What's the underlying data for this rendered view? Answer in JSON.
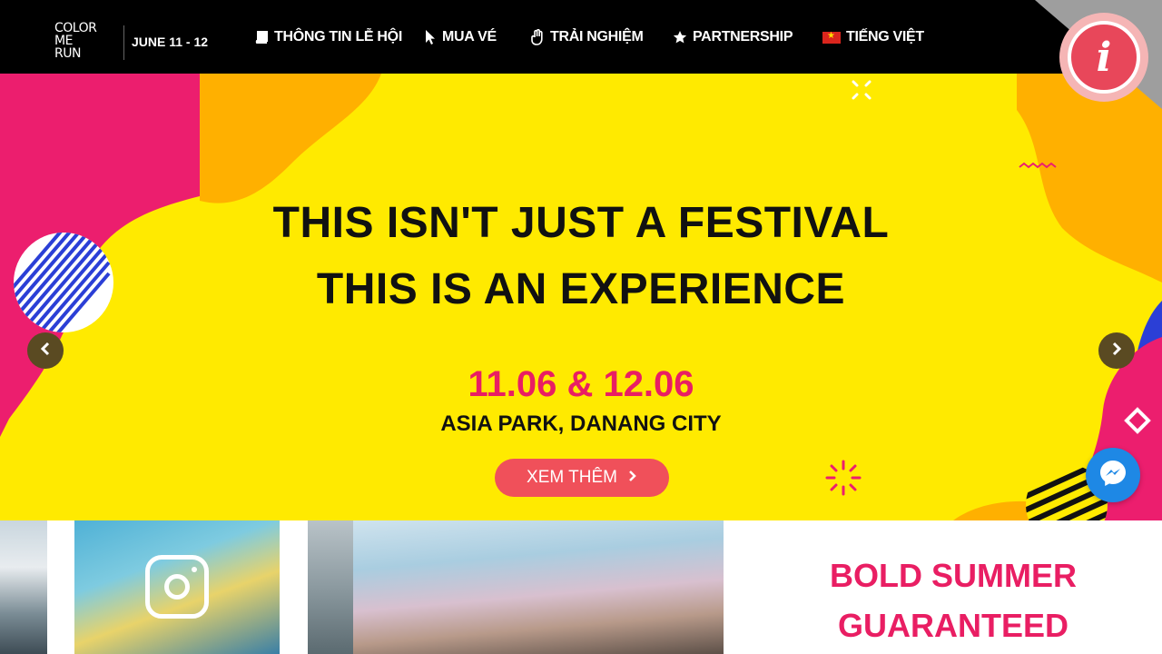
{
  "header": {
    "logo_lines": [
      "COLOR",
      "ME",
      "RUN"
    ],
    "dates": "JUNE 11 - 12",
    "nav": [
      {
        "label": "THÔNG TIN LỄ HỘI",
        "icon": "book-icon"
      },
      {
        "label": "MUA VÉ",
        "icon": "cursor-icon"
      },
      {
        "label": "TRẢI NGHIỆM",
        "icon": "hand-icon"
      },
      {
        "label": "PARTNERSHIP",
        "icon": "star-icon"
      },
      {
        "label": "TIẾNG VIỆT",
        "icon": "vietnam-flag-icon"
      }
    ],
    "info_badge_icon": "info-icon"
  },
  "hero": {
    "headline_1": "THIS ISN'T JUST A FESTIVAL",
    "headline_2": "THIS IS AN EXPERIENCE",
    "event_dates": "11.06 & 12.06",
    "location": "ASIA PARK, DANANG CITY",
    "cta_label": "XEM THÊM",
    "prev_icon": "chevron-left-icon",
    "next_icon": "chevron-right-icon",
    "messenger_icon": "messenger-icon"
  },
  "bottom": {
    "title_1": "BOLD SUMMER",
    "title_2": "GUARANTEED",
    "instagram_icon": "instagram-icon"
  },
  "colors": {
    "nav_bg": "#000000",
    "hero_bg": "#ffea00",
    "pink": "#e91e63",
    "cta_bg": "#f0505a",
    "orange": "#ffb000",
    "blue": "#2b3fd6"
  }
}
